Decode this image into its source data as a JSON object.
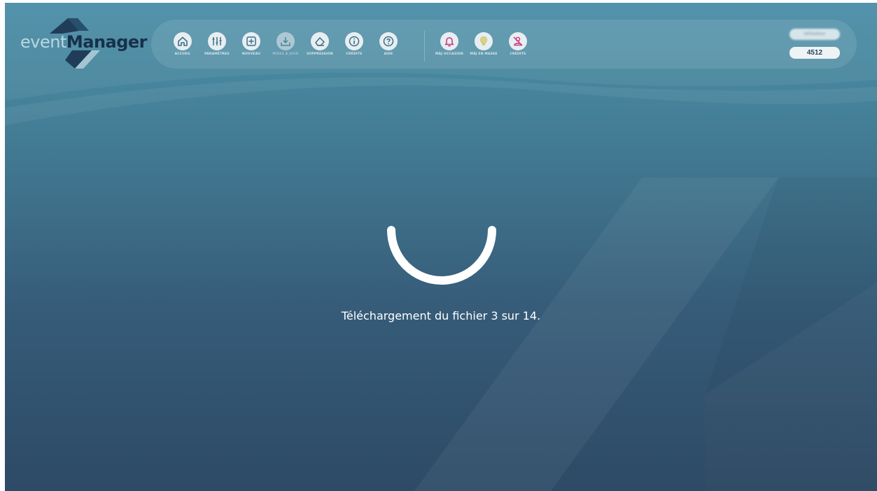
{
  "app": {
    "logo": {
      "part1": "event",
      "part2": "Manager"
    }
  },
  "toolbar": {
    "items": [
      {
        "label": "ACCUEIL",
        "icon": "home-icon",
        "icon_color": "#3f6f86",
        "enabled": true
      },
      {
        "label": "PARAMÈTRES",
        "icon": "sliders-icon",
        "icon_color": "#3f6f86",
        "enabled": true
      },
      {
        "label": "NOUVEAU",
        "icon": "plus-square-icon",
        "icon_color": "#3f6f86",
        "enabled": true
      },
      {
        "label": "MISES À JOUR",
        "icon": "download-icon",
        "icon_color": "#3f6f86",
        "enabled": false
      },
      {
        "label": "SUPPRESSION",
        "icon": "eraser-icon",
        "icon_color": "#3f6f86",
        "enabled": true
      },
      {
        "label": "CRÉDITS",
        "icon": "info-icon",
        "icon_color": "#3f6f86",
        "enabled": true
      },
      {
        "label": "AIDE",
        "icon": "help-icon",
        "icon_color": "#3f6f86",
        "enabled": true
      },
      {
        "label": "MÀJ OCCASION",
        "icon": "bell-icon",
        "icon_color": "#c8357a",
        "enabled": true
      },
      {
        "label": "MÀJ EN MASSE",
        "icon": "lightbulb-icon",
        "icon_color": "#c9c66a",
        "enabled": true
      },
      {
        "label": "CRÉDITS",
        "icon": "no-person-icon",
        "icon_color": "#c8357a",
        "enabled": true
      }
    ]
  },
  "account": {
    "user": "Utilisateur",
    "code": "4512"
  },
  "status": {
    "message": "Téléchargement du fichier 3 sur 14."
  },
  "colors": {
    "accent_pink": "#c8357a",
    "accent_yellow": "#c9c66a",
    "icon_base": "#3f6f86"
  }
}
